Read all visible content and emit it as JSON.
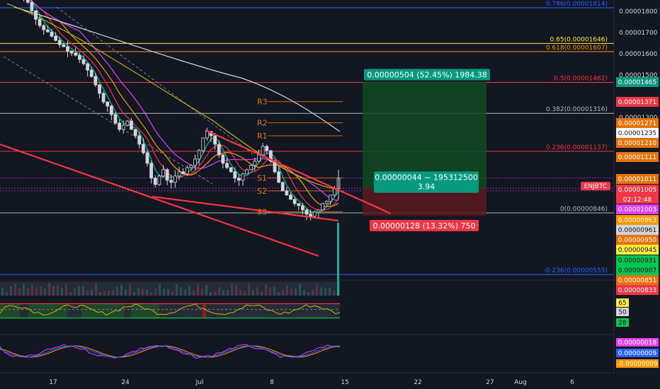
{
  "chart_data": {
    "type": "candlestick",
    "symbol": "ENJBTC",
    "countdown": "02:12:48",
    "x_ticks": [
      "17",
      "24",
      "Jul",
      "8",
      "15",
      "22",
      "27",
      "Aug",
      "6"
    ],
    "price_axis_ticks": [
      "0.00001800",
      "0.00001700",
      "0.00001600",
      "0.00001500",
      "0.00001300",
      "0.00001200",
      "0.00001100"
    ],
    "fib_levels": [
      {
        "label": "0.786(0.00001814)",
        "price": 1.814e-05,
        "color": "#2962ff"
      },
      {
        "label": "0.65(0.00001646)",
        "price": 1.646e-05,
        "color": "#ffeb3b"
      },
      {
        "label": "0.618(0.00001607)",
        "price": 1.607e-05,
        "color": "#ff9800"
      },
      {
        "label": "0.5(0.00001462)",
        "price": 1.462e-05,
        "color": "#f23645"
      },
      {
        "label": "0.382(0.00001316)",
        "price": 1.316e-05,
        "color": "#b2b5be"
      },
      {
        "label": "0.236(0.00001137)",
        "price": 1.137e-05,
        "color": "#f23645"
      },
      {
        "label": "0(0.00000846)",
        "price": 8.46e-06,
        "color": "#b2b5be"
      },
      {
        "label": "-0.236(0.00000555)",
        "price": 5.55e-06,
        "color": "#2962ff"
      }
    ],
    "price_tags": [
      {
        "text": "0.00001465",
        "price": 1.465e-05,
        "bg": "#089981",
        "fg": "#ffffff"
      },
      {
        "text": "0.00001371",
        "price": 1.371e-05,
        "bg": "#f23645",
        "fg": "#ffffff"
      },
      {
        "text": "0.00001271",
        "price": 1.271e-05,
        "bg": "#e8730c",
        "fg": "#ffffff"
      },
      {
        "text": "0.00001235",
        "price": 1.235e-05,
        "bg": "#ffffff",
        "fg": "#131722"
      },
      {
        "text": "0.00001210",
        "price": 1.21e-05,
        "bg": "#e8730c",
        "fg": "#ffffff"
      },
      {
        "text": "0.00001111",
        "price": 1.111e-05,
        "bg": "#e8730c",
        "fg": "#ffffff"
      },
      {
        "text": "0.00001011",
        "price": 1.011e-05,
        "bg": "#e8730c",
        "fg": "#ffffff"
      },
      {
        "text": "0.00001005",
        "price": 1.005e-05,
        "bg": "#f23645",
        "fg": "#ffffff"
      },
      {
        "text": "0.00001003",
        "price": 1.003e-05,
        "bg": "#e040fb",
        "fg": "#ffffff"
      },
      {
        "text": "0.00000963",
        "price": 9.63e-06,
        "bg": "#ff9800",
        "fg": "#ffffff"
      },
      {
        "text": "0.00000961",
        "price": 9.61e-06,
        "bg": "#d1d4dc",
        "fg": "#131722"
      },
      {
        "text": "0.00000950",
        "price": 9.5e-06,
        "bg": "#e8730c",
        "fg": "#ffffff"
      },
      {
        "text": "0.00000945",
        "price": 9.45e-06,
        "bg": "#ffeb3b",
        "fg": "#131722"
      },
      {
        "text": "0.00000931",
        "price": 9.31e-06,
        "bg": "#00c853",
        "fg": "#131722"
      },
      {
        "text": "0.00000907",
        "price": 9.07e-06,
        "bg": "#00c853",
        "fg": "#131722"
      },
      {
        "text": "0.00000851",
        "price": 8.51e-06,
        "bg": "#e8730c",
        "fg": "#ffffff"
      },
      {
        "text": "0.00000833",
        "price": 8.33e-06,
        "bg": "#f23645",
        "fg": "#ffffff"
      }
    ],
    "pivots": [
      {
        "label": "R3",
        "price": 1.371e-05
      },
      {
        "label": "R2",
        "price": 1.271e-05
      },
      {
        "label": "R1",
        "price": 1.21e-05
      },
      {
        "label": "S1",
        "price": 1.011e-05
      },
      {
        "label": "S2",
        "price": 9.5e-06
      },
      {
        "label": "S3",
        "price": 8.51e-06
      }
    ],
    "long_position": {
      "target_label": "0.00000504 (52.45%) 1984.38",
      "entry_label_1": "0.00000044 ~ 195312500",
      "entry_label_2": "3.94",
      "stop_label": "0.00000128 (13.32%) 750",
      "target_price": 1.465e-05,
      "entry_price": 9.61e-06,
      "stop_price": 8.33e-06
    },
    "rsi": {
      "ticks": [
        "65",
        "50",
        "28"
      ],
      "upper": 65,
      "middle": 50,
      "lower": 28
    },
    "macd": {
      "ticks": [
        "0.00000018",
        "0.00000009",
        "-0.00000009"
      ]
    },
    "close_series": [
      1.88e-05,
      1.86e-05,
      1.84e-05,
      1.8e-05,
      1.76e-05,
      1.73e-05,
      1.71e-05,
      1.7e-05,
      1.68e-05,
      1.66e-05,
      1.64e-05,
      1.63e-05,
      1.61e-05,
      1.6e-05,
      1.59e-05,
      1.57e-05,
      1.55e-05,
      1.52e-05,
      1.49e-05,
      1.45e-05,
      1.41e-05,
      1.37e-05,
      1.35e-05,
      1.31e-05,
      1.27e-05,
      1.24e-05,
      1.26e-05,
      1.28e-05,
      1.24e-05,
      1.21e-05,
      1.17e-05,
      1.13e-05,
      1.08e-05,
      1.01e-05,
      9.8e-06,
      1.02e-05,
      1.05e-05,
      1e-05,
      9.9e-06,
      1.02e-05,
      1.04e-05,
      1.03e-05,
      1.06e-05,
      1.07e-05,
      1.1e-05,
      1.14e-05,
      1.2e-05,
      1.23e-05,
      1.21e-05,
      1.17e-05,
      1.12e-05,
      1.08e-05,
      1.06e-05,
      1.04e-05,
      1.01e-05,
      1e-05,
      1.03e-05,
      1.05e-05,
      1.07e-05,
      1.09e-05,
      1.12e-05,
      1.16e-05,
      1.14e-05,
      1.09e-05,
      1.04e-05,
      9.9e-06,
      9.5e-06,
      9.3e-06,
      9.1e-06,
      8.9e-06,
      8.8e-06,
      8.6e-06,
      8.4e-06,
      8.3e-06,
      8.5e-06,
      8.6e-06,
      8.9e-06,
      9e-06,
      9.3e-06,
      9.6e-06,
      1.01e-05
    ]
  }
}
